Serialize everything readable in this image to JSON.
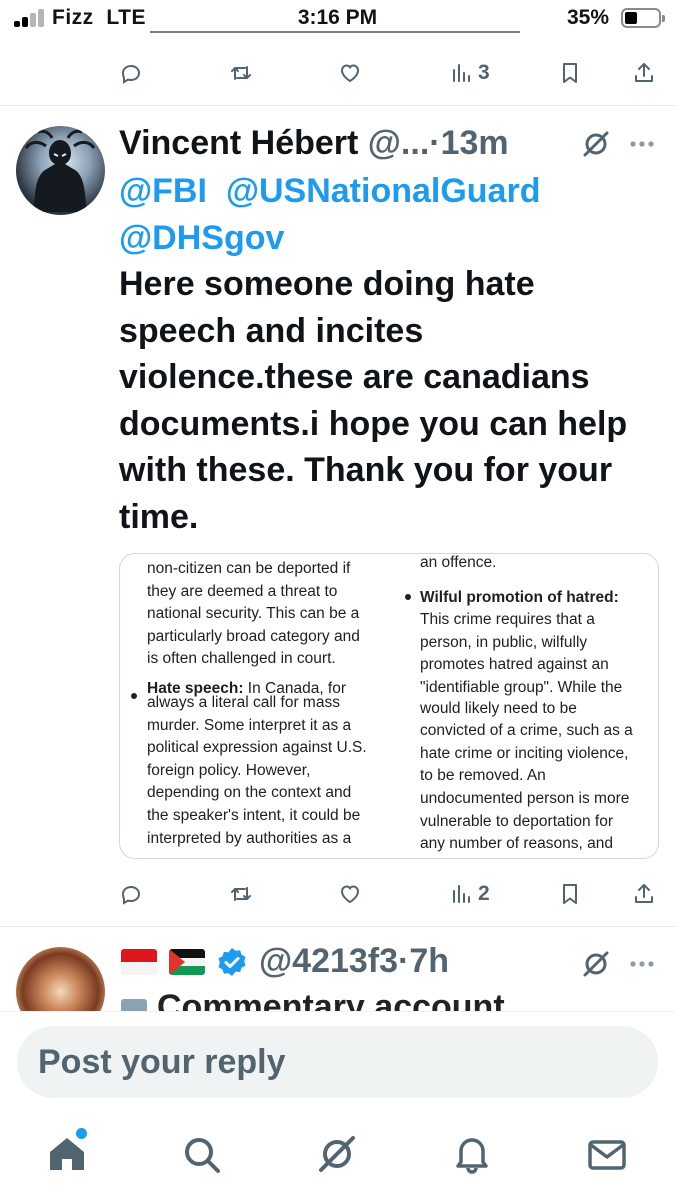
{
  "status_bar": {
    "carrier": "Fizz",
    "network": "LTE",
    "time": "3:16 PM",
    "battery_percent": "35%",
    "battery_level": 0.35
  },
  "top_actions": {
    "views_count": "3"
  },
  "tweet": {
    "author_name": "Vincent Hébert",
    "handle_truncated": "@...",
    "separator": "·",
    "time_ago": "13m",
    "mentions": [
      "@FBI",
      "@USNationalGuard",
      "@DHSgov"
    ],
    "body_lines": [
      "Here someone doing hate",
      "speech and incites",
      "violence.these are canadians",
      "documents.i hope you can help",
      "with these. Thank you for your",
      "time."
    ],
    "media": {
      "left_column": [
        "non-citizen can be deported if",
        "they are deemed a threat to",
        "national security. This can be a",
        "particularly broad category and",
        "is often challenged in court."
      ],
      "left_bullet_title": "Hate speech:",
      "left_bullet_text": " In Canada, for",
      "left_column_lower": [
        "always a literal call for mass",
        "murder. Some interpret it as a",
        "political expression against U.S.",
        "foreign policy. However,",
        "depending on the context and",
        "the speaker's intent, it could be",
        "interpreted by authorities as a"
      ],
      "right_top_line": "an offence.",
      "right_bullet_title": "Wilful promotion of hatred:",
      "right_column": [
        "This crime requires that a",
        "person, in public, wilfully",
        "promotes hatred against an",
        "\"identifiable group\". While the"
      ],
      "right_column_lower": [
        "would likely need to be",
        "convicted of a crime, such as a",
        "hate crime or inciting violence,",
        "to be removed. An",
        "undocumented person is more",
        "vulnerable to deportation for",
        "any number of reasons, and"
      ]
    },
    "views_count": "2"
  },
  "tweet2": {
    "handle": "@4213f3",
    "separator": "·",
    "time_ago": "7h",
    "partial_text": "Commentary account"
  },
  "reply": {
    "placeholder": "Post your reply"
  },
  "colors": {
    "accent": "#1d9bf0",
    "icon_gray": "#536471",
    "text": "#0f1419"
  },
  "icons": {
    "reply": "reply-icon",
    "repost": "repost-icon",
    "like": "heart-icon",
    "views": "views-icon",
    "bookmark": "bookmark-icon",
    "share": "share-icon",
    "grok": "grok-icon",
    "more": "more-icon",
    "nav": [
      "home-icon",
      "search-icon",
      "grok-icon",
      "notifications-icon",
      "messages-icon"
    ]
  }
}
